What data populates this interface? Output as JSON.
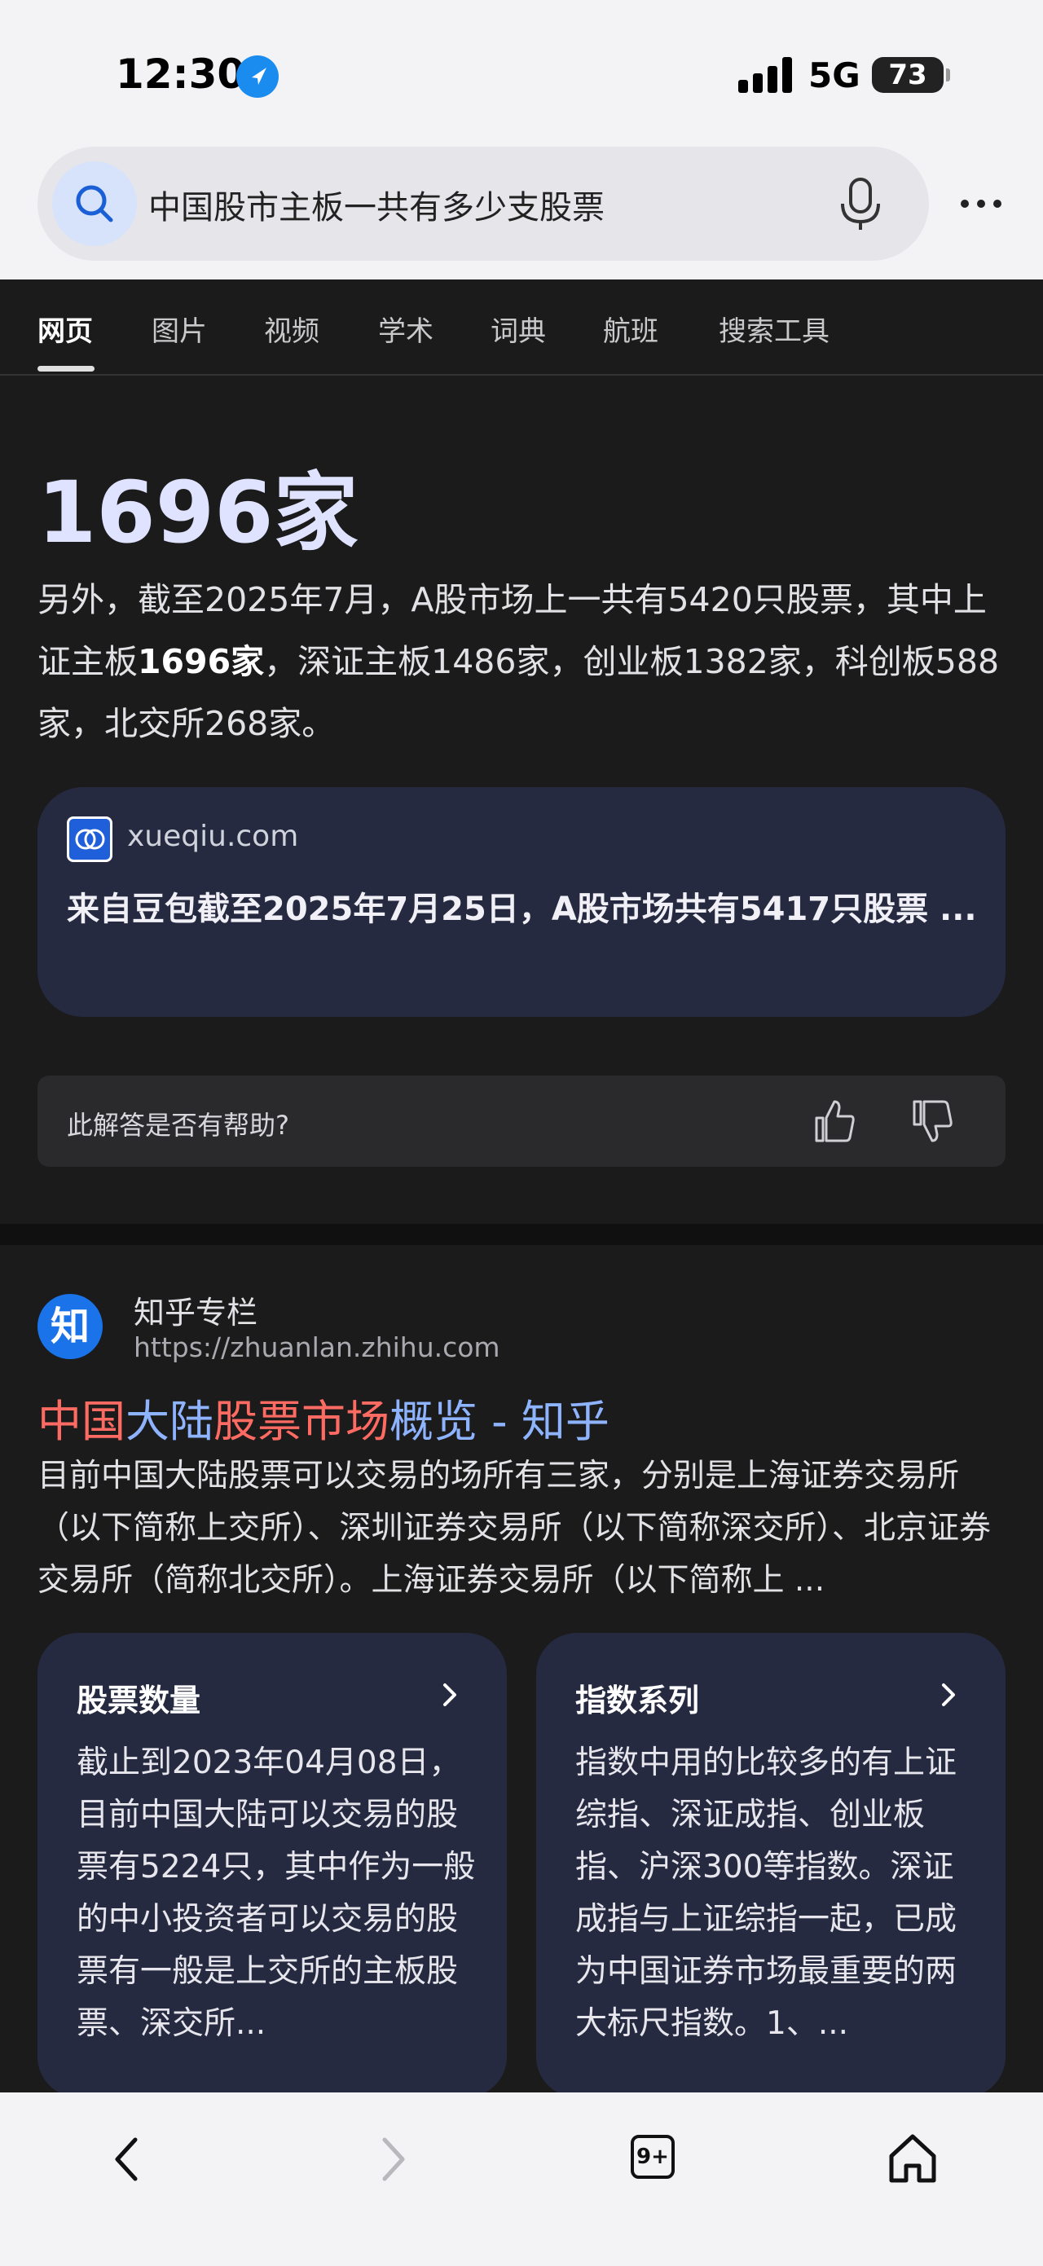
{
  "status_bar": {
    "time": "12:30",
    "network": "5G",
    "battery": "73"
  },
  "search": {
    "query": "中国股市主板一共有多少支股票"
  },
  "tabs": [
    {
      "label": "网页",
      "active": true
    },
    {
      "label": "图片"
    },
    {
      "label": "视频"
    },
    {
      "label": "学术"
    },
    {
      "label": "词典"
    },
    {
      "label": "航班"
    },
    {
      "label": "搜索工具"
    }
  ],
  "answer": {
    "headline": "1696家",
    "text_before": "另外，截至2025年7月，A股市场上一共有5420只股票，其中上证主板",
    "text_bold": "1696家",
    "text_after": "，深证主板1486家，创业板1382家，科创板588家，北交所268家。",
    "source": {
      "domain": "xueqiu.com",
      "title": "来自豆包截至2025年7月25日，A股市场共有5417只股票 ..."
    },
    "feedback_prompt": "此解答是否有帮助?"
  },
  "result": {
    "site_logo_char": "知",
    "site_name": "知乎专栏",
    "url": "https://zhuanlan.zhihu.com",
    "title_parts": [
      {
        "text": "中国",
        "highlight": true
      },
      {
        "text": "大陆",
        "highlight": false
      },
      {
        "text": "股票市场",
        "highlight": true
      },
      {
        "text": "概览 - 知乎",
        "highlight": false
      }
    ],
    "snippet": "目前中国大陆股票可以交易的场所有三家，分别是上海证券交易所（以下简称上交所）、深圳证券交易所（以下简称深交所）、北京证券交易所（简称北交所）。上海证券交易所（以下简称上 ...",
    "cards": [
      {
        "heading": "股票数量",
        "body": "截止到2023年04月08日，目前中国大陆可以交易的股票有5224只，其中作为一般的中小投资者可以交易的股票有一般是上交所的主板股票、深交所..."
      },
      {
        "heading": "指数系列",
        "body": "指数中用的比较多的有上证综指、深证成指、创业板指、沪深300等指数。深证成指与上证综指一起，已成为中国证券市场最重要的两大标尺指数。1、..."
      }
    ]
  },
  "toolbar": {
    "tab_count": "9+"
  },
  "colors": {
    "accent_blue": "#1a8cf0",
    "title_link": "#8fb4ff",
    "title_highlight": "#ff6b63",
    "card_bg": "#262a41"
  }
}
